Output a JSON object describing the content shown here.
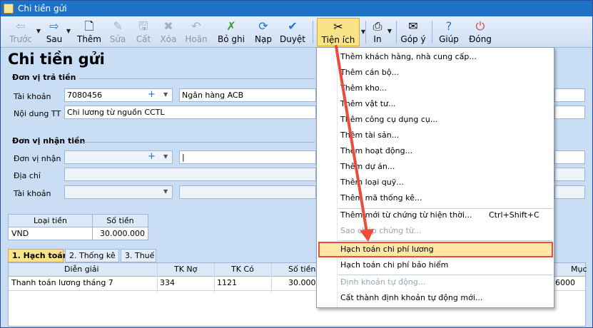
{
  "window": {
    "title": "Chi tiền gửi"
  },
  "toolbar": {
    "buttons": [
      {
        "label": "Trước",
        "icon": "⇦"
      },
      {
        "label": "Sau",
        "icon": "⇨"
      },
      {
        "label": "Thêm",
        "icon": "🗋"
      },
      {
        "label": "Sửa",
        "icon": "✎"
      },
      {
        "label": "Cất",
        "icon": "🖫"
      },
      {
        "label": "Xóa",
        "icon": "✖"
      },
      {
        "label": "Hoãn",
        "icon": "↶"
      },
      {
        "label": "Bỏ ghi",
        "icon": "✗"
      },
      {
        "label": "Nạp",
        "icon": "⟳"
      },
      {
        "label": "Duyệt",
        "icon": "✔"
      },
      {
        "label": "Tiện ích",
        "icon": "✂"
      },
      {
        "label": "In",
        "icon": "⎙"
      },
      {
        "label": "Góp ý",
        "icon": "✉"
      },
      {
        "label": "Giúp",
        "icon": "?"
      },
      {
        "label": "Đóng",
        "icon": "⏻"
      }
    ]
  },
  "page": {
    "title": "Chi tiền gửi"
  },
  "payer": {
    "section": "Đơn vị trả tiền",
    "account_label": "Tài khoản",
    "account_value": "7080456",
    "bank_value": "Ngân hàng ACB",
    "content_label": "Nội dung TT",
    "content_value": "Chi lương từ nguồn CCTL"
  },
  "payee": {
    "section": "Đơn vị nhận tiền",
    "unit_label": "Đơn vị nhận",
    "address_label": "Địa chỉ",
    "account_label": "Tài khoản"
  },
  "currency": {
    "col1": "Loại tiền",
    "col2": "Số tiền",
    "currency_value": "VND",
    "amount_value": "30.000.000"
  },
  "tabs": [
    {
      "label": "1. Hạch toán"
    },
    {
      "label": "2. Thống kê"
    },
    {
      "label": "3. Thuế"
    }
  ],
  "grid": {
    "headers": [
      "Diễn giải",
      "TK Nợ",
      "TK Có",
      "Số tiền",
      "Mục"
    ],
    "row": {
      "desc": "Thanh toán lương tháng 7",
      "debit": "334",
      "credit": "1121",
      "amount": "30.000.0",
      "tail": "6000"
    }
  },
  "menu": {
    "items": [
      {
        "label": "Thêm khách hàng, nhà cung cấp..."
      },
      {
        "label": "Thêm cán bộ..."
      },
      {
        "label": "Thêm kho..."
      },
      {
        "label": "Thêm vật tư..."
      },
      {
        "label": "Thêm công cụ dụng cụ..."
      },
      {
        "label": "Thêm tài sản..."
      },
      {
        "label": "Thêm hoạt động..."
      },
      {
        "label": "Thêm dự án..."
      },
      {
        "label": "Thêm loại quỹ..."
      },
      {
        "label": "Thêm mã thống kê..."
      },
      {
        "label": "Thêm mới từ chứng từ hiện thời...",
        "shortcut": "Ctrl+Shift+C"
      },
      {
        "label": "Sao chép chứng từ..."
      },
      {
        "label": "Hạch toán chi phí lương"
      },
      {
        "label": "Hạch toán chi phí bảo hiểm"
      },
      {
        "label": "Định khoản tự động..."
      },
      {
        "label": "Cất thành định khoản tự động mới..."
      }
    ]
  },
  "colors": {
    "titlebar": "#1e73c8",
    "highlight_border": "#ee4b3a",
    "arrow": "#ee4b3a"
  }
}
